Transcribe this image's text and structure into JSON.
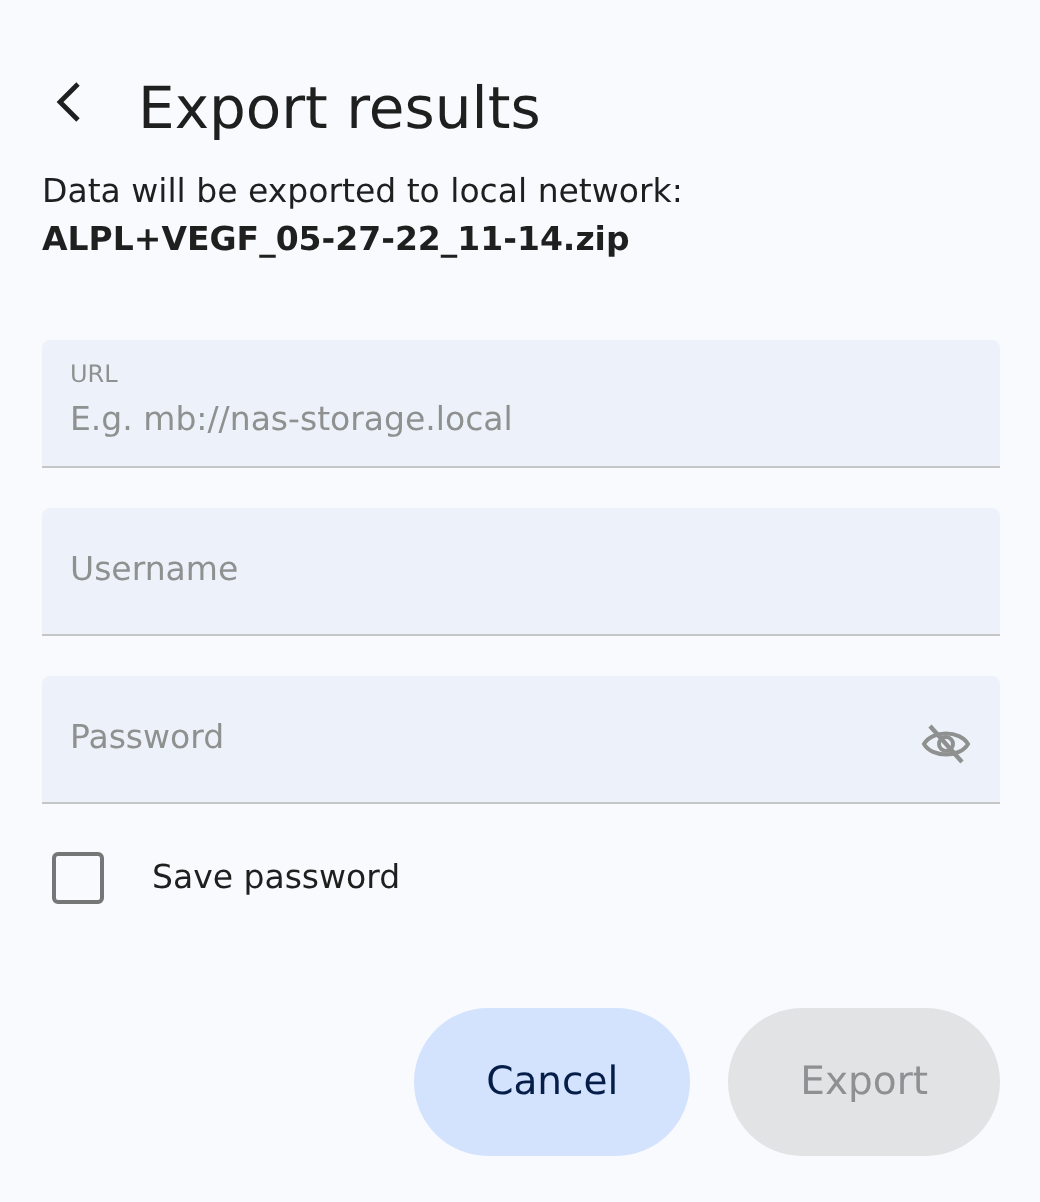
{
  "header": {
    "title": "Export results"
  },
  "message": {
    "text": "Data will be exported to local network:",
    "filename": "ALPL+VEGF_05-27-22_11-14.zip"
  },
  "fields": [
    {
      "kind": "text",
      "label": "URL",
      "placeholder": "E.g. mb://nas-storage.local"
    },
    {
      "kind": "text",
      "placeholder": "Username"
    },
    {
      "kind": "password",
      "placeholder": "Password"
    }
  ],
  "save_password": {
    "label": "Save password",
    "checked": false
  },
  "buttons": [
    {
      "label": "Cancel",
      "disabled": false
    },
    {
      "label": "Export",
      "disabled": true
    }
  ]
}
